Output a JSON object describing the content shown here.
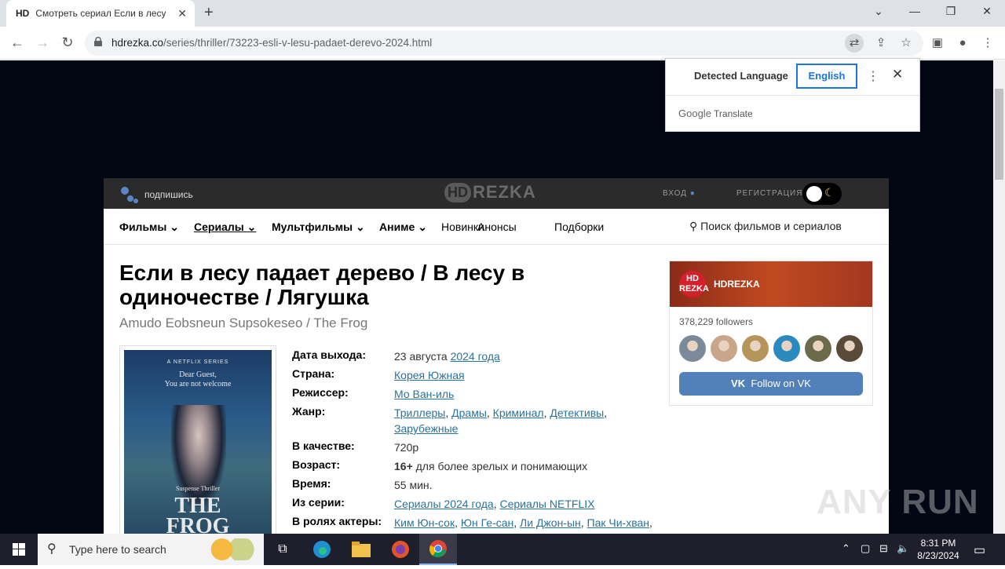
{
  "browser": {
    "tab_favicon": "HD",
    "tab_title": "Смотреть сериал Если в лесу падает дерево",
    "url_domain": "hdrezka.co",
    "url_path": "/series/thriller/73223-esli-v-lesu-padaet-derevo-2024.html"
  },
  "translate": {
    "detected": "Detected Language",
    "english": "English",
    "brand_google": "Google",
    "brand_translate": "Translate"
  },
  "site": {
    "subscribe": "подпишись",
    "logo_hd": "HD",
    "logo_rezka": "REZKA",
    "login": "ВХОД",
    "register": "РЕГИСТРАЦИЯ",
    "nav": [
      "Фильмы",
      "Сериалы",
      "Мультфильмы",
      "Аниме",
      "Новинки",
      "Анонсы",
      "Подборки"
    ],
    "search_placeholder": "Поиск фильмов и сериалов"
  },
  "movie": {
    "title": "Если в лесу падает дерево / В лесу в одиночестве / Лягушка",
    "original_title": "Amudo Eobsneun Supsokeseo / The Frog",
    "poster": {
      "top": "A NETFLIX SERIES",
      "line1": "Dear Guest,",
      "line2": "You are not welcome",
      "genre": "Suspense Thriller",
      "name": "THE FROG"
    },
    "info": {
      "release_label": "Дата выхода:",
      "release_date": "23 августа",
      "release_year": "2024 года",
      "country_label": "Страна:",
      "country": "Корея Южная",
      "director_label": "Режиссер:",
      "director": "Мо Ван-иль",
      "genre_label": "Жанр:",
      "genres": [
        "Триллеры",
        "Драмы",
        "Криминал",
        "Детективы",
        "Зарубежные"
      ],
      "quality_label": "В качестве:",
      "quality": "720p",
      "age_label": "Возраст:",
      "age": "16+",
      "age_desc": "для более зрелых и понимающих",
      "time_label": "Время:",
      "time": "55 мин.",
      "series_label": "Из серии:",
      "series": [
        "Сериалы 2024 года",
        "Сериалы NETFLIX"
      ],
      "cast_label": "В ролях актеры:",
      "cast": [
        "Ким Юн-сок",
        "Юн Ге-сан",
        "Ли Джон-ын",
        "Пак Чи-хван"
      ]
    }
  },
  "vk": {
    "avatar_text": "HD REZKA",
    "name": "HDREZKA",
    "followers": "378,229 followers",
    "follow_button": "Follow on VK",
    "follower_colors": [
      "#7a8a9a",
      "#c9a58a",
      "#b5955a",
      "#2a8ac0",
      "#6b6a4a",
      "#5a4a3a"
    ]
  },
  "watermark": "ANY RUN",
  "taskbar": {
    "search_placeholder": "Type here to search",
    "time": "8:31 PM",
    "date": "8/23/2024"
  }
}
